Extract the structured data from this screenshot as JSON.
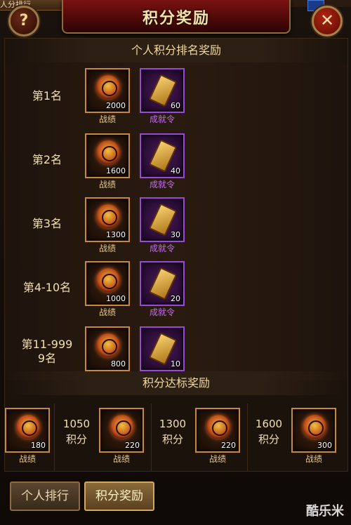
{
  "header": {
    "title": "积分奖励",
    "help_icon_label": "?",
    "close_icon_label": "✕"
  },
  "top_left_tab": {
    "label": "人分排行"
  },
  "ranking_section": {
    "title": "个人积分排名奖励",
    "rows": [
      {
        "rank": "第1名",
        "rewards": [
          {
            "icon": "medal-icon",
            "name": "战绩",
            "count": "2000"
          },
          {
            "icon": "token-icon",
            "name": "成就令",
            "count": "60"
          }
        ]
      },
      {
        "rank": "第2名",
        "rewards": [
          {
            "icon": "medal-icon",
            "name": "战绩",
            "count": "1600"
          },
          {
            "icon": "token-icon",
            "name": "成就令",
            "count": "40"
          }
        ]
      },
      {
        "rank": "第3名",
        "rewards": [
          {
            "icon": "medal-icon",
            "name": "战绩",
            "count": "1300"
          },
          {
            "icon": "token-icon",
            "name": "成就令",
            "count": "30"
          }
        ]
      },
      {
        "rank": "第4-10名",
        "rewards": [
          {
            "icon": "medal-icon",
            "name": "战绩",
            "count": "1000"
          },
          {
            "icon": "token-icon",
            "name": "成就令",
            "count": "20"
          }
        ]
      },
      {
        "rank_line1": "第11-999",
        "rank_line2": "9名",
        "rewards": [
          {
            "icon": "medal-icon",
            "count": "800"
          },
          {
            "icon": "token-icon",
            "count": "10"
          }
        ]
      }
    ]
  },
  "threshold_section": {
    "title": "积分达标奖励",
    "items": [
      {
        "points": "",
        "unit": "",
        "reward": {
          "icon": "medal-icon",
          "name": "战绩",
          "count": "180"
        }
      },
      {
        "points": "1050",
        "unit": "积分",
        "reward": {
          "icon": "medal-icon",
          "name": "战绩",
          "count": "220"
        }
      },
      {
        "points": "1300",
        "unit": "积分",
        "reward": {
          "icon": "medal-icon",
          "name": "战绩",
          "count": "220"
        }
      },
      {
        "points": "1600",
        "unit": "积分",
        "reward": {
          "icon": "medal-icon",
          "name": "战绩",
          "count": "300"
        }
      }
    ]
  },
  "bottom_tabs": {
    "personal_rank": "个人排行",
    "points_reward": "积分奖励",
    "active": "积分奖励"
  },
  "watermark": "酷乐米",
  "colors": {
    "title_red": "#7a1212",
    "gold_border": "#c88a3a",
    "purple_border": "#9a48d8",
    "purple_text": "#c070e8"
  }
}
